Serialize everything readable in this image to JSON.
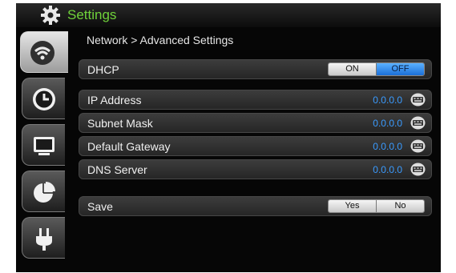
{
  "app": {
    "title": "Settings"
  },
  "breadcrumb": "Network > Advanced Settings",
  "sidebar": {
    "tabs": [
      {
        "icon": "wifi-icon",
        "active": true
      },
      {
        "icon": "clock-icon",
        "active": false
      },
      {
        "icon": "monitor-icon",
        "active": false
      },
      {
        "icon": "pie-chart-icon",
        "active": false
      },
      {
        "icon": "power-plug-icon",
        "active": false
      }
    ]
  },
  "dhcp": {
    "label": "DHCP",
    "on_label": "ON",
    "off_label": "OFF",
    "selected": "OFF"
  },
  "fields": [
    {
      "label": "IP Address",
      "value": "0.0.0.0",
      "icon": "keyboard-icon"
    },
    {
      "label": "Subnet Mask",
      "value": "0.0.0.0",
      "icon": "keyboard-icon"
    },
    {
      "label": "Default Gateway",
      "value": "0.0.0.0",
      "icon": "keyboard-icon"
    },
    {
      "label": "DNS Server",
      "value": "0.0.0.0",
      "icon": "keyboard-icon"
    }
  ],
  "save": {
    "label": "Save",
    "yes_label": "Yes",
    "no_label": "No"
  },
  "colors": {
    "title_green": "#6fd23a",
    "value_blue": "#3a9bff",
    "toggle_blue": "#2a86f0"
  }
}
